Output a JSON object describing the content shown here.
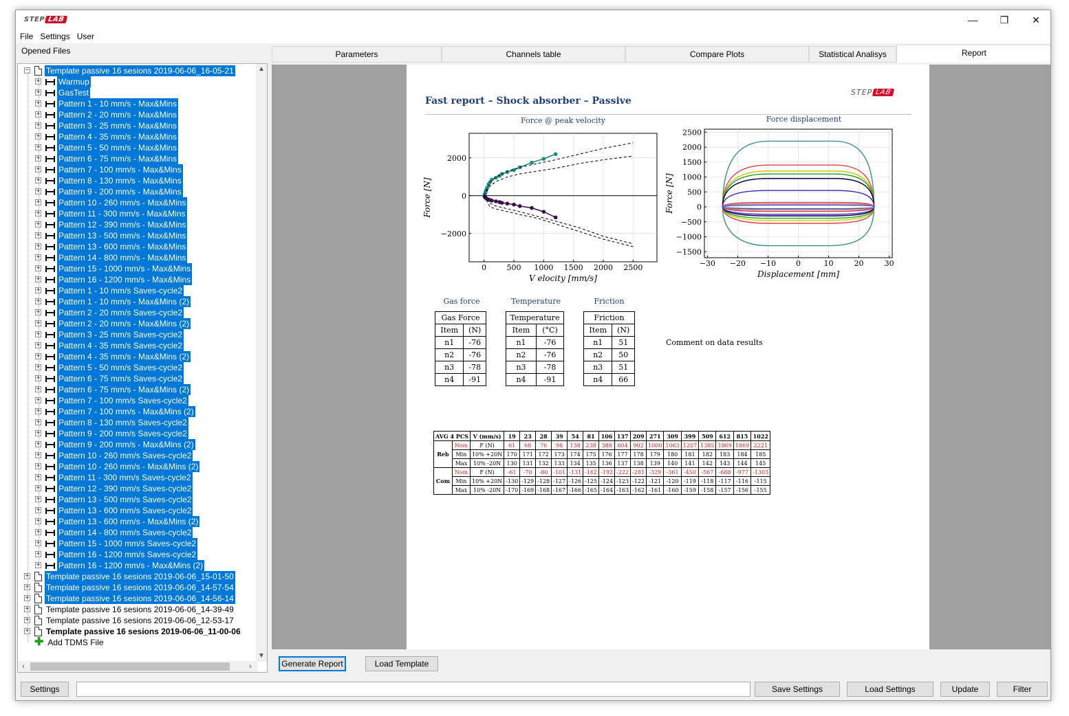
{
  "titlebar": {
    "logo_left": "STEP",
    "logo_right": "LAB",
    "minimize": "—",
    "restore": "❐",
    "close": "✕"
  },
  "menu": {
    "file": "File",
    "settings": "Settings",
    "user": "User"
  },
  "left_panel": {
    "label": "Opened Files"
  },
  "tree": {
    "root_expanded": "Template passive 16 sesions 2019-06-06_16-05-21",
    "children": [
      {
        "label": "Warmup",
        "selected": true
      },
      {
        "label": "GasTest",
        "selected": true
      },
      {
        "label": "Pattern 1 - 10 mm/s - Max&Mins",
        "selected": true
      },
      {
        "label": "Pattern 2 - 20 mm/s - Max&Mins",
        "selected": true
      },
      {
        "label": "Pattern 3 - 25 mm/s - Max&Mins",
        "selected": true
      },
      {
        "label": "Pattern 4 - 35 mm/s - Max&Mins",
        "selected": true
      },
      {
        "label": "Pattern 5 - 50 mm/s - Max&Mins",
        "selected": true
      },
      {
        "label": "Pattern 6 - 75 mm/s - Max&Mins",
        "selected": true
      },
      {
        "label": "Pattern 7 - 100 mm/s - Max&Mins",
        "selected": true
      },
      {
        "label": "Pattern 8 - 130 mm/s - Max&Mins",
        "selected": true
      },
      {
        "label": "Pattern 9 - 200 mm/s - Max&Mins",
        "selected": true
      },
      {
        "label": "Pattern 10 - 260 mm/s - Max&Mins",
        "selected": true
      },
      {
        "label": "Pattern 11 - 300 mm/s - Max&Mins",
        "selected": true
      },
      {
        "label": "Pattern 12 - 390 mm/s - Max&Mins",
        "selected": true
      },
      {
        "label": "Pattern 13 - 500 mm/s - Max&Mins",
        "selected": true
      },
      {
        "label": "Pattern 13 - 600 mm/s - Max&Mins",
        "selected": true
      },
      {
        "label": "Pattern 14 - 800 mm/s - Max&Mins",
        "selected": true
      },
      {
        "label": "Pattern 15 - 1000 mm/s - Max&Mins",
        "selected": true
      },
      {
        "label": "Pattern 16 - 1200 mm/s - Max&Mins",
        "selected": true
      },
      {
        "label": "Pattern 1 - 10 mm/s Saves-cycle2",
        "selected": true
      },
      {
        "label": "Pattern 1 - 10 mm/s - Max&Mins (2)",
        "selected": true
      },
      {
        "label": "Pattern 2 - 20 mm/s Saves-cycle2",
        "selected": true
      },
      {
        "label": "Pattern 2 - 20 mm/s - Max&Mins (2)",
        "selected": true
      },
      {
        "label": "Pattern 3 - 25 mm/s Saves-cycle2",
        "selected": true
      },
      {
        "label": "Pattern 4 - 35 mm/s Saves-cycle2",
        "selected": true
      },
      {
        "label": "Pattern 4 - 35 mm/s - Max&Mins (2)",
        "selected": true
      },
      {
        "label": "Pattern 5 - 50 mm/s Saves-cycle2",
        "selected": true
      },
      {
        "label": "Pattern 6 - 75 mm/s Saves-cycle2",
        "selected": true
      },
      {
        "label": "Pattern 6 - 75 mm/s - Max&Mins (2)",
        "selected": true
      },
      {
        "label": "Pattern 7 - 100 mm/s Saves-cycle2",
        "selected": true
      },
      {
        "label": "Pattern 7 - 100 mm/s - Max&Mins (2)",
        "selected": true
      },
      {
        "label": "Pattern 8 - 130 mm/s Saves-cycle2",
        "selected": true
      },
      {
        "label": "Pattern 9 - 200 mm/s Saves-cycle2",
        "selected": true
      },
      {
        "label": "Pattern 9 - 200 mm/s - Max&Mins (2)",
        "selected": true
      },
      {
        "label": "Pattern 10 - 260 mm/s Saves-cycle2",
        "selected": true
      },
      {
        "label": "Pattern 10 - 260 mm/s - Max&Mins (2)",
        "selected": true
      },
      {
        "label": "Pattern 11 - 300 mm/s Saves-cycle2",
        "selected": true
      },
      {
        "label": "Pattern 12 - 390 mm/s Saves-cycle2",
        "selected": true
      },
      {
        "label": "Pattern 13 - 500 mm/s Saves-cycle2",
        "selected": true
      },
      {
        "label": "Pattern 13 - 600 mm/s Saves-cycle2",
        "selected": true
      },
      {
        "label": "Pattern 13 - 600 mm/s - Max&Mins (2)",
        "selected": true
      },
      {
        "label": "Pattern 14 - 800 mm/s Saves-cycle2",
        "selected": true
      },
      {
        "label": "Pattern 15 - 1000 mm/s Saves-cycle2",
        "selected": true
      },
      {
        "label": "Pattern 16 - 1200 mm/s Saves-cycle2",
        "selected": true
      },
      {
        "label": "Pattern 16 - 1200 mm/s - Max&Mins (2)",
        "selected": true
      }
    ],
    "roots": [
      {
        "label": "Template passive 16 sesions 2019-06-06_15-01-50",
        "selected": true,
        "bold": false
      },
      {
        "label": "Template passive 16 sesions 2019-06-06_14-57-54",
        "selected": true,
        "bold": false
      },
      {
        "label": "Template passive 16 sesions 2019-06-06_14-56-14",
        "selected": true,
        "bold": false
      },
      {
        "label": "Template passive 16 sesions 2019-06-06_14-39-49",
        "selected": false,
        "bold": false
      },
      {
        "label": "Template passive 16 sesions 2019-06-06_12-53-17",
        "selected": false,
        "bold": false
      },
      {
        "label": "Template passive 16 sesions 2019-06-06_11-00-06",
        "selected": false,
        "bold": true
      }
    ],
    "add_file": "Add TDMS File"
  },
  "tabs": [
    "Parameters",
    "Channels table",
    "Compare Plots",
    "Statistical Analisys",
    "Report"
  ],
  "active_tab": "Report",
  "report": {
    "title": "Fast report – Shock absorber – Passive",
    "logo_left": "STEP",
    "logo_right": "LAB",
    "chart1_title": "Force @ peak velocity",
    "chart2_title": "Force displacement",
    "gas_caption": "Gas force",
    "temp_caption": "Temperature",
    "fric_caption": "Friction",
    "comment": "Comment on data results",
    "gas_table": {
      "title": "Gas Force",
      "col1": "Item",
      "col2": "(N)",
      "rows": [
        [
          "n1",
          "-76"
        ],
        [
          "n2",
          "-76"
        ],
        [
          "n3",
          "-78"
        ],
        [
          "n4",
          "-91"
        ]
      ]
    },
    "temp_table": {
      "title": "Temperature",
      "col1": "Item",
      "col2": "(°C)",
      "rows": [
        [
          "n1",
          "-76"
        ],
        [
          "n2",
          "-76"
        ],
        [
          "n3",
          "-78"
        ],
        [
          "n4",
          "-91"
        ]
      ]
    },
    "fric_table": {
      "title": "Friction",
      "col1": "Item",
      "col2": "(N)",
      "rows": [
        [
          "n1",
          "51"
        ],
        [
          "n2",
          "50"
        ],
        [
          "n3",
          "51"
        ],
        [
          "n4",
          "66"
        ]
      ]
    },
    "avg_table": {
      "h1": "AVG 4 PCS",
      "h2": "V (mm/s)",
      "speeds": [
        "19",
        "23",
        "28",
        "39",
        "54",
        "81",
        "106",
        "137",
        "209",
        "271",
        "309",
        "399",
        "509",
        "612",
        "815",
        "1022"
      ],
      "groups": [
        {
          "name": "Reb",
          "rows": [
            {
              "type": "Nom",
              "spec": "F (N)",
              "red": true,
              "values": [
                "61",
                "68",
                "76",
                "98",
                "138",
                "238",
                "388",
                "604",
                "902",
                "1000",
                "1063",
                "1207",
                "1385",
                "1869",
                "1869",
                "2221"
              ]
            },
            {
              "type": "Min",
              "spec": "10% +20N",
              "red": false,
              "values": [
                "170",
                "171",
                "172",
                "173",
                "174",
                "175",
                "176",
                "177",
                "178",
                "179",
                "180",
                "181",
                "182",
                "183",
                "184",
                "185"
              ]
            },
            {
              "type": "Max",
              "spec": "10% -20N",
              "red": false,
              "values": [
                "130",
                "131",
                "132",
                "133",
                "134",
                "135",
                "136",
                "137",
                "138",
                "139",
                "140",
                "141",
                "142",
                "143",
                "144",
                "145"
              ]
            }
          ]
        },
        {
          "name": "Com",
          "rows": [
            {
              "type": "Nom",
              "spec": "F (N)",
              "red": true,
              "values": [
                "-61",
                "-70",
                "-80",
                "-101",
                "-131",
                "-162",
                "-192",
                "-222",
                "-281",
                "-329",
                "-361",
                "-450",
                "-567",
                "-688",
                "-977",
                "-1303"
              ]
            },
            {
              "type": "Min",
              "spec": "10% +20N",
              "red": false,
              "values": [
                "-130",
                "-129",
                "-128",
                "-127",
                "-126",
                "-125",
                "-124",
                "-123",
                "-122",
                "-121",
                "-120",
                "-119",
                "-118",
                "-117",
                "-116",
                "-115"
              ]
            },
            {
              "type": "Max",
              "spec": "10% -20N",
              "red": false,
              "values": [
                "-170",
                "-169",
                "-168",
                "-167",
                "-166",
                "-165",
                "-164",
                "-163",
                "-162",
                "-161",
                "-160",
                "-159",
                "-158",
                "-157",
                "-156",
                "-155"
              ]
            }
          ]
        }
      ]
    }
  },
  "chart_data": [
    {
      "type": "scatter",
      "title": "Force @ peak velocity",
      "xlabel": "V elocity [mm/s]",
      "ylabel": "Force [N]",
      "xlim": [
        -250,
        2900
      ],
      "ylim": [
        -3500,
        3300
      ],
      "xticks": [
        0,
        500,
        1000,
        1500,
        2000,
        2500
      ],
      "yticks": [
        -2000,
        0,
        2000
      ],
      "xtick_labels": [
        "0",
        "500",
        "1000",
        "1500",
        "2000",
        "2500"
      ],
      "ytick_labels": [
        "−2000",
        "0",
        "2000"
      ],
      "grid": true,
      "series": [
        {
          "color": "#1a8c80",
          "x": [
            10,
            20,
            25,
            35,
            50,
            75,
            100,
            130,
            200,
            260,
            300,
            390,
            500,
            600,
            800,
            1000,
            1200
          ],
          "y": [
            60,
            120,
            200,
            300,
            420,
            600,
            720,
            850,
            950,
            1050,
            1150,
            1250,
            1350,
            1500,
            1750,
            1950,
            2200
          ]
        },
        {
          "color": "#3a0d4a",
          "x": [
            10,
            20,
            25,
            35,
            50,
            75,
            100,
            130,
            200,
            260,
            300,
            390,
            500,
            600,
            800,
            1000,
            1200
          ],
          "y": [
            -60,
            -90,
            -110,
            -140,
            -170,
            -200,
            -230,
            -260,
            -300,
            -340,
            -380,
            -420,
            -470,
            -550,
            -650,
            -850,
            -1150
          ]
        },
        {
          "color": "#000000",
          "dashed": true,
          "x": [
            0,
            100,
            200,
            400,
            600,
            900,
            1200,
            1600,
            2000,
            2500
          ],
          "y": [
            0,
            700,
            1000,
            1300,
            1500,
            1700,
            1900,
            2200,
            2500,
            2800
          ]
        },
        {
          "color": "#000000",
          "dashed": true,
          "x": [
            0,
            100,
            200,
            400,
            600,
            900,
            1200,
            1600,
            2000,
            2500
          ],
          "y": [
            0,
            500,
            750,
            1000,
            1150,
            1300,
            1450,
            1700,
            1900,
            2100
          ]
        },
        {
          "color": "#000000",
          "dashed": true,
          "x": [
            0,
            100,
            200,
            400,
            600,
            900,
            1200,
            1600,
            2000,
            2500
          ],
          "y": [
            0,
            -600,
            -700,
            -850,
            -1000,
            -1200,
            -1500,
            -1900,
            -2300,
            -2700
          ]
        },
        {
          "color": "#000000",
          "dashed": true,
          "x": [
            0,
            100,
            200,
            400,
            600,
            900,
            1200,
            1600,
            2000,
            2500
          ],
          "y": [
            0,
            -400,
            -550,
            -700,
            -850,
            -1100,
            -1350,
            -1700,
            -2150,
            -2550
          ]
        }
      ]
    },
    {
      "type": "line",
      "title": "Force displacement",
      "xlabel": "Displacement [mm]",
      "ylabel": "Force [N]",
      "xlim": [
        -31,
        31
      ],
      "ylim": [
        -1700,
        2600
      ],
      "xticks": [
        -30,
        -20,
        -10,
        0,
        10,
        20,
        30
      ],
      "yticks": [
        -1500,
        -1000,
        -500,
        0,
        500,
        1000,
        1500,
        2000,
        2500
      ],
      "xtick_labels": [
        "−30",
        "−20",
        "−10",
        "0",
        "10",
        "20",
        "30"
      ],
      "ytick_labels": [
        "−1500",
        "−1000",
        "−500",
        "0",
        "500",
        "1000",
        "1500",
        "2000",
        "2500"
      ],
      "grid": true,
      "loops": [
        {
          "color": "#3a8f8a",
          "top": 2200,
          "bottom": -1300
        },
        {
          "color": "#e04040",
          "top": 1400,
          "bottom": -550
        },
        {
          "color": "#c8c800",
          "top": 1200,
          "bottom": -450
        },
        {
          "color": "#20a020",
          "top": 1100,
          "bottom": -380
        },
        {
          "color": "#000040",
          "top": 950,
          "bottom": -300
        },
        {
          "color": "#4020c0",
          "top": 550,
          "bottom": -250
        },
        {
          "color": "#c03060",
          "top": 150,
          "bottom": -150
        },
        {
          "color": "#e08030",
          "top": 100,
          "bottom": -100
        },
        {
          "color": "#3050e0",
          "top": 60,
          "bottom": -60
        }
      ]
    }
  ],
  "buttons": {
    "generate": "Generate Report",
    "load_template": "Load Template",
    "settings": "Settings",
    "save_settings": "Save Settings",
    "load_settings": "Load Settings",
    "update": "Update",
    "filter": "Filter"
  }
}
